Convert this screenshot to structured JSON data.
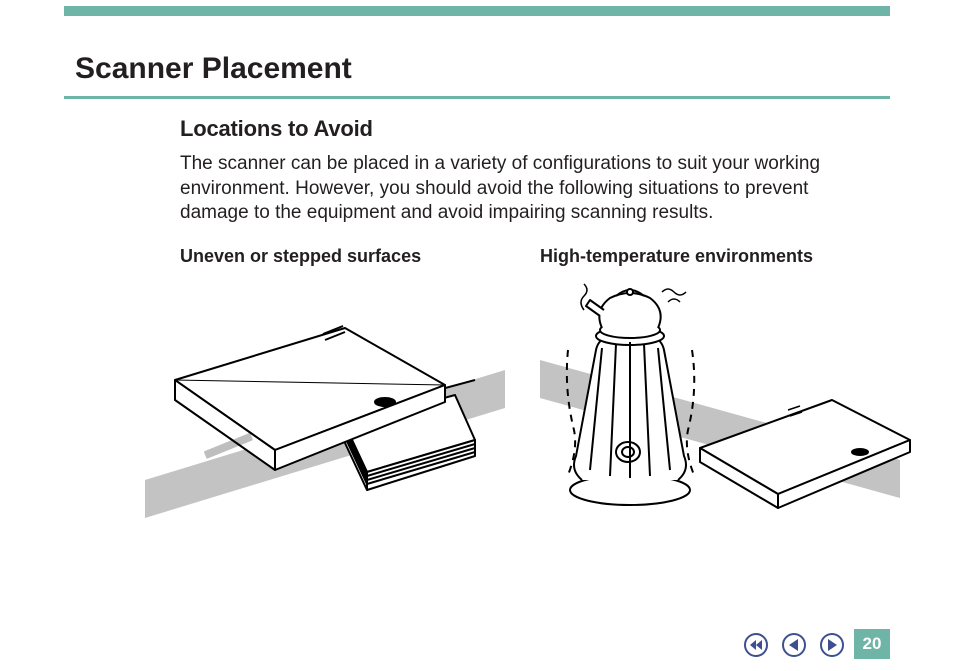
{
  "page": {
    "title": "Scanner Placement",
    "section_heading": "Locations to Avoid",
    "body_text": "The scanner can be placed in a variety of configurations to suit your working environment. However, you should avoid the following situations to prevent damage to the equipment and avoid impairing scanning results.",
    "subheading_left": "Uneven or stepped surfaces",
    "subheading_right": "High-temperature environments",
    "page_number": "20"
  },
  "nav": {
    "first_icon": "first-page-icon",
    "prev_icon": "previous-page-icon",
    "next_icon": "next-page-icon"
  },
  "illustrations": {
    "left_alt": "Scanner tilted on the edge of a book (uneven surface)",
    "right_alt": "Scanner next to a heater with a steaming kettle on top"
  }
}
